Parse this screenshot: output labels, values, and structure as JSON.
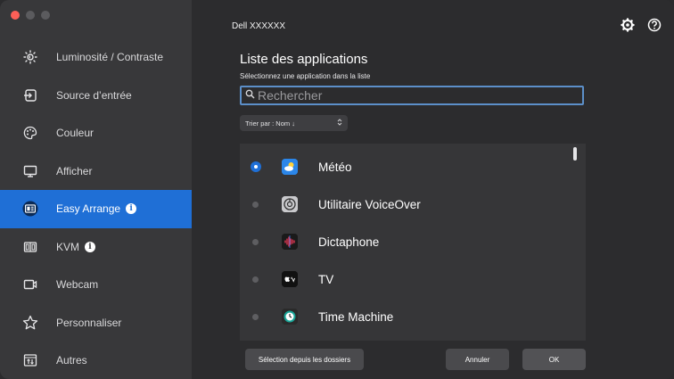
{
  "window": {
    "title": "Dell XXXXXX"
  },
  "sidebar": {
    "items": [
      {
        "label": "Luminosité / Contraste",
        "icon": "brightness-icon",
        "active": false,
        "info": false
      },
      {
        "label": "Source d’entrée",
        "icon": "input-source-icon",
        "active": false,
        "info": false
      },
      {
        "label": "Couleur",
        "icon": "color-icon",
        "active": false,
        "info": false
      },
      {
        "label": "Afficher",
        "icon": "display-icon",
        "active": false,
        "info": false
      },
      {
        "label": "Easy Arrange",
        "icon": "easy-arrange-icon",
        "active": true,
        "info": true
      },
      {
        "label": "KVM",
        "icon": "kvm-icon",
        "active": false,
        "info": true
      },
      {
        "label": "Webcam",
        "icon": "webcam-icon",
        "active": false,
        "info": false
      },
      {
        "label": "Personnaliser",
        "icon": "star-icon",
        "active": false,
        "info": false
      },
      {
        "label": "Autres",
        "icon": "others-icon",
        "active": false,
        "info": false
      }
    ]
  },
  "main": {
    "heading": "Liste des applications",
    "subheading": "Sélectionnez une application dans la liste",
    "search": {
      "placeholder": "Rechercher",
      "value": ""
    },
    "sort": {
      "label": "Trier par : Nom ↓"
    },
    "apps": [
      {
        "name": "Météo",
        "icon": "weather-app-icon",
        "selected": true
      },
      {
        "name": "Utilitaire VoiceOver",
        "icon": "voiceover-app-icon",
        "selected": false
      },
      {
        "name": "Dictaphone",
        "icon": "voice-memos-app-icon",
        "selected": false
      },
      {
        "name": "TV",
        "icon": "tv-app-icon",
        "selected": false
      },
      {
        "name": "Time Machine",
        "icon": "time-machine-app-icon",
        "selected": false
      }
    ],
    "buttons": {
      "folders": "Sélection depuis les dossiers",
      "cancel": "Annuler",
      "ok": "OK"
    }
  },
  "colors": {
    "accent": "#1f6fd6",
    "sidebar_bg": "#38383a",
    "main_bg": "#2c2c2e"
  }
}
